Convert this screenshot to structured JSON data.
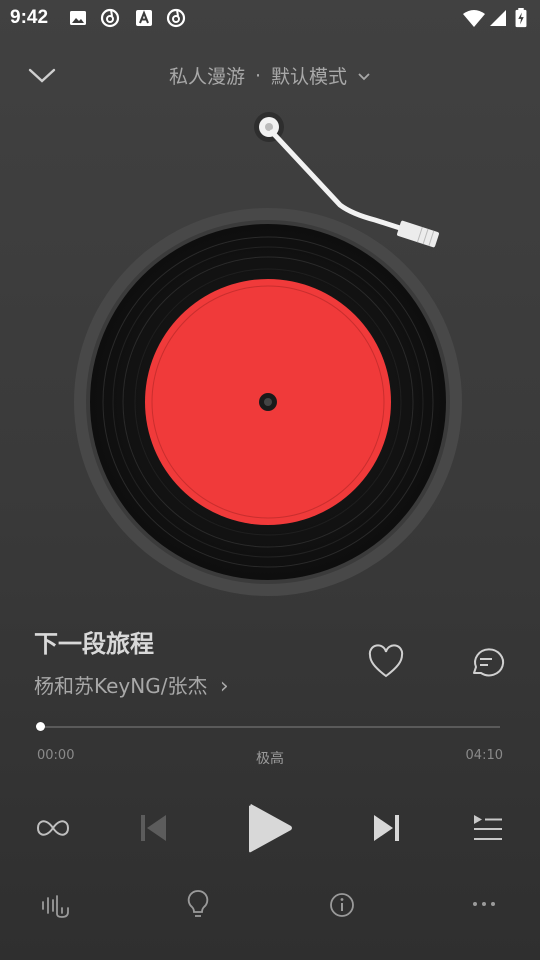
{
  "status_bar": {
    "time": "9:42",
    "icons_left": [
      "image-icon",
      "netease-music-icon",
      "font-a-icon",
      "netease-music-icon"
    ],
    "icons_right": [
      "wifi-icon",
      "signal-icon",
      "battery-icon"
    ]
  },
  "header": {
    "mode": "私人漫游",
    "separator": "·",
    "sub_mode": "默认模式"
  },
  "song": {
    "title": "下一段旅程",
    "artist": "杨和苏KeyNG/张杰",
    "artist_chevron": "›"
  },
  "progress": {
    "current": "00:00",
    "quality": "极高",
    "duration": "04:10",
    "fraction": 0.0
  },
  "controls": [
    "loop-infinite-icon",
    "previous-icon",
    "play-icon",
    "next-icon",
    "playlist-icon"
  ],
  "bottom_actions": [
    "audio-effect-icon",
    "lightbulb-icon",
    "info-icon",
    "more-icon"
  ],
  "colors": {
    "background": "#3a3a3a",
    "record_label": "#f03a3a",
    "record_vinyl": "#161616"
  }
}
